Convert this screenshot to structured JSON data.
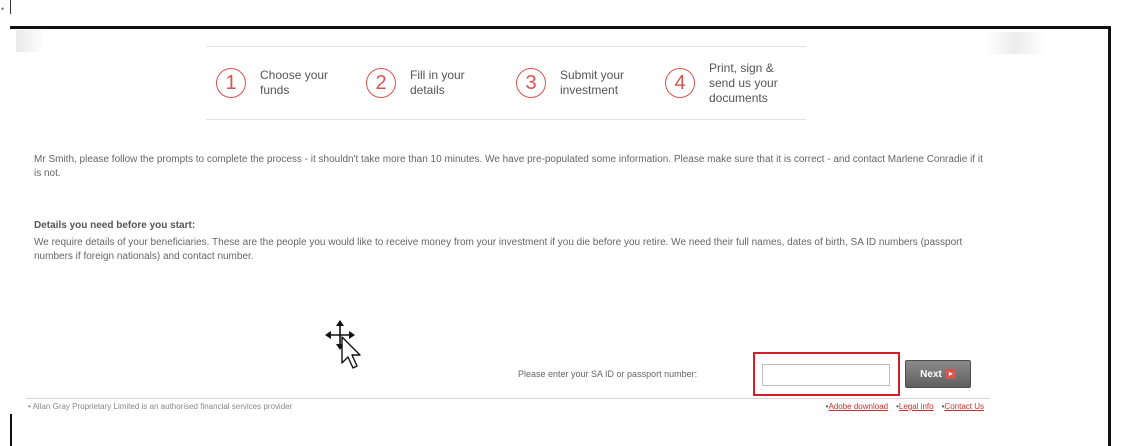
{
  "page": {
    "corner_mark": "•"
  },
  "steps": [
    {
      "number": "1",
      "label": "Choose your\nfunds"
    },
    {
      "number": "2",
      "label": "Fill in your\ndetails"
    },
    {
      "number": "3",
      "label": "Submit your\ninvestment"
    },
    {
      "number": "4",
      "label": "Print, sign &\nsend us your\ndocuments"
    }
  ],
  "intro_text": "Mr Smith, please follow the prompts to complete the process - it shouldn't take more than 10 minutes. We have pre-populated some information. Please make sure that it is correct - and contact Marlene Conradie if it is not.",
  "details": {
    "heading": "Details you need before you start:",
    "body": "We require details of your beneficiaries. These are the people you would like to receive money from your investment if you die before you retire. We need their full names, dates of birth, SA ID numbers (passport numbers if foreign nationals) and contact number."
  },
  "id_form": {
    "label": "Please enter your SA ID or passport number:",
    "value": "",
    "placeholder": "",
    "next_label": "Next",
    "next_arrow": "▸"
  },
  "footer": {
    "disclaimer": "• Allan Gray Proprietary Limited is an authorised financial services provider",
    "links": [
      {
        "label": "Adobe download"
      },
      {
        "label": "Legal info"
      },
      {
        "label": "Contact Us"
      }
    ]
  },
  "colors": {
    "accent": "#d9534f",
    "highlight": "#d61e2a",
    "link": "#c9302c",
    "button": "#6e6e6e"
  },
  "icons": {
    "cursor": "move-cursor-icon"
  }
}
